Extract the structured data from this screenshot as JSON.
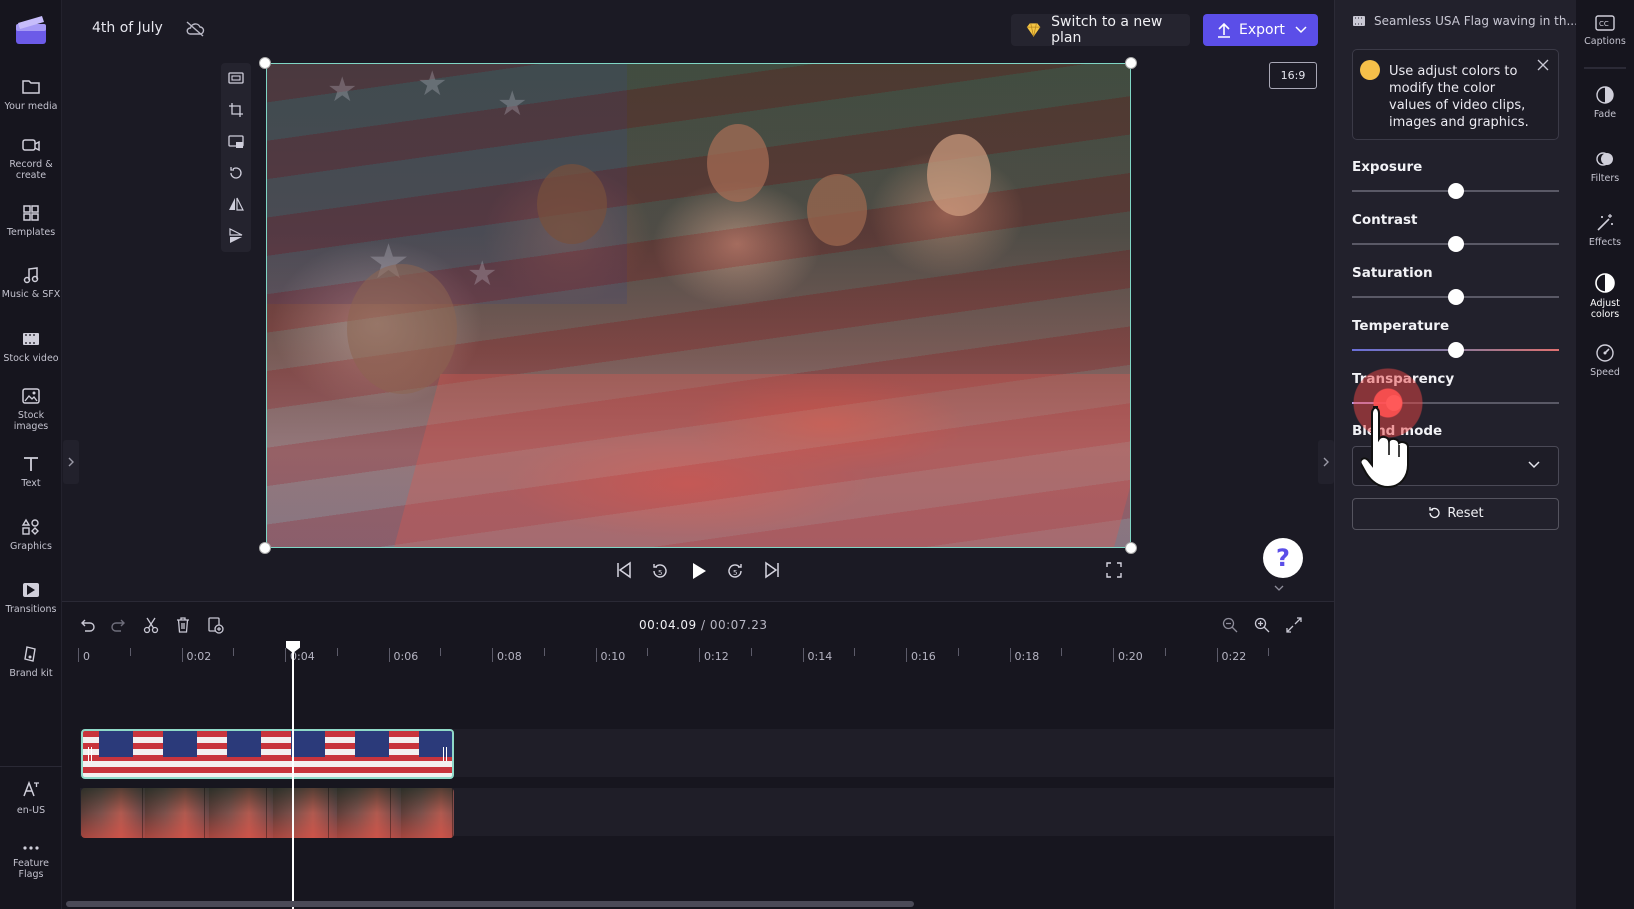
{
  "project": {
    "title": "4th of July"
  },
  "left_nav": [
    {
      "key": "your-media",
      "label": "Your media"
    },
    {
      "key": "record-create",
      "label": "Record &\ncreate"
    },
    {
      "key": "templates",
      "label": "Templates"
    },
    {
      "key": "music-sfx",
      "label": "Music & SFX"
    },
    {
      "key": "stock-video",
      "label": "Stock video"
    },
    {
      "key": "stock-images",
      "label": "Stock\nimages"
    },
    {
      "key": "text",
      "label": "Text"
    },
    {
      "key": "graphics",
      "label": "Graphics"
    },
    {
      "key": "transitions",
      "label": "Transitions"
    },
    {
      "key": "brand-kit",
      "label": "Brand kit"
    },
    {
      "key": "language",
      "label": "en-US"
    },
    {
      "key": "feature-flags",
      "label": "Feature\nFlags"
    }
  ],
  "topbar": {
    "plan_label": "Switch to a new plan",
    "export_label": "Export",
    "aspect_ratio": "16:9"
  },
  "timeline": {
    "current_time": "00:04.09",
    "total_time": "/ 00:07.23",
    "ruler_labels": [
      "0",
      "0:02",
      "0:04",
      "0:06",
      "0:08",
      "0:10",
      "0:12",
      "0:14",
      "0:16",
      "0:18",
      "0:20",
      "0:22"
    ]
  },
  "right_panel": {
    "clip_name": "Seamless USA Flag waving in th...",
    "tip_text": "Use adjust colors to modify the color values of video clips, images and graphics.",
    "controls": [
      {
        "label": "Exposure",
        "value": 0.5
      },
      {
        "label": "Contrast",
        "value": 0.5
      },
      {
        "label": "Saturation",
        "value": 0.5
      },
      {
        "label": "Temperature",
        "value": 0.5
      },
      {
        "label": "Transparency",
        "value": 0.18
      }
    ],
    "blend_label": "Blend mode",
    "blend_value": "N",
    "reset_label": "Reset"
  },
  "rail": [
    {
      "key": "captions",
      "label": "Captions"
    },
    {
      "key": "fade",
      "label": "Fade"
    },
    {
      "key": "filters",
      "label": "Filters"
    },
    {
      "key": "effects",
      "label": "Effects"
    },
    {
      "key": "adjust-colors",
      "label": "Adjust\ncolors",
      "active": true
    },
    {
      "key": "speed",
      "label": "Speed"
    }
  ],
  "colors": {
    "accent": "#5b4ee8",
    "selection": "#7fd6c5",
    "panel": "#22212c"
  }
}
